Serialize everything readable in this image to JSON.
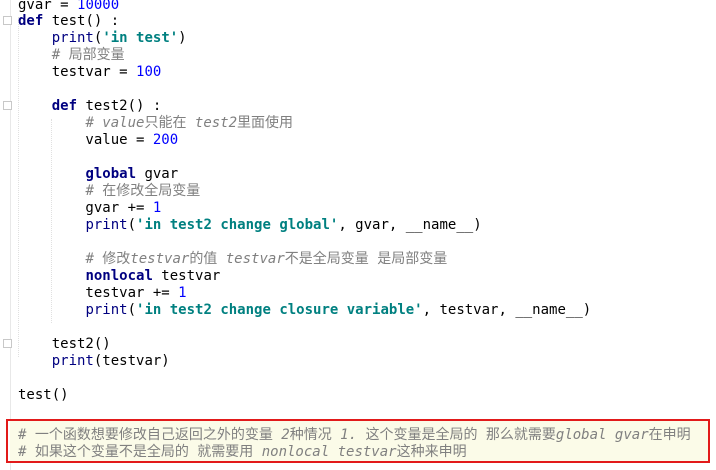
{
  "editor": {
    "lines": [
      "gvar = 10000",
      "def test() :",
      "    print('in test')",
      "    # 局部变量",
      "    testvar = 100",
      "",
      "    def test2() :",
      "        # value只能在 test2里面使用",
      "        value = 200",
      "",
      "        global gvar",
      "        # 在修改全局变量",
      "        gvar += 1",
      "        print('in test2 change global', gvar, __name__)",
      "",
      "        # 修改testvar的值 testvar不是全局变量 是局部变量",
      "        nonlocal testvar",
      "        testvar += 1",
      "        print('in test2 change closure variable', testvar, __name__)",
      "",
      "    test2()",
      "    print(testvar)",
      "",
      "test()",
      "",
      "# 一个函数想要修改自己返回之外的变量 2种情况 1. 这个变量是全局的 那么就需要global gvar在申明",
      "# 如果这个变量不是全局的 就需要用 nonlocal testvar这种来申明"
    ]
  },
  "colors": {
    "keyword": "#000080",
    "string": "#008080",
    "number": "#0000ff",
    "comment": "#808080",
    "highlight_border": "#e21a1a"
  }
}
